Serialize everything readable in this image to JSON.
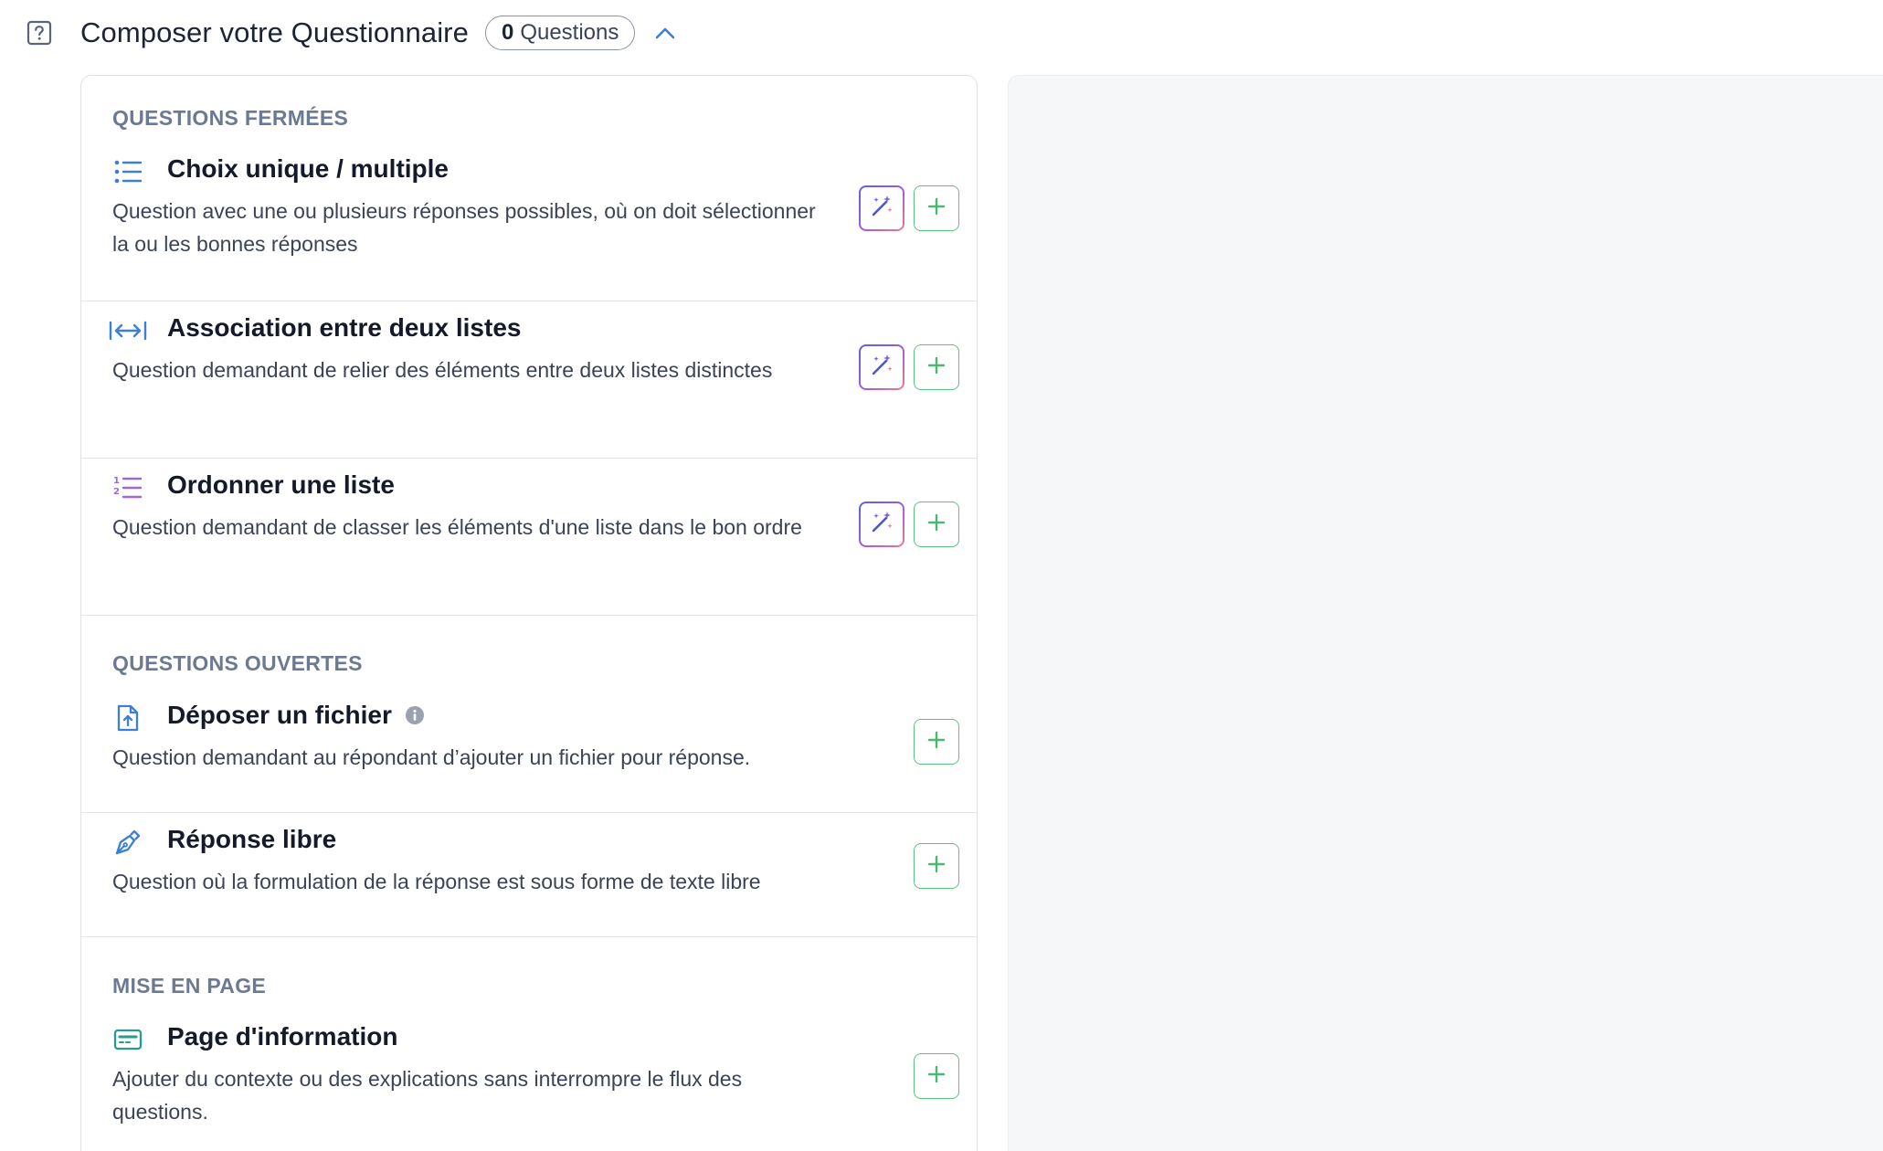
{
  "header": {
    "title": "Composer votre Questionnaire",
    "question_count": "0",
    "question_count_label": "Questions"
  },
  "sections": {
    "closed": {
      "label": "QUESTIONS FERMÉES"
    },
    "open": {
      "label": "QUESTIONS OUVERTES"
    },
    "layout": {
      "label": "MISE EN PAGE"
    }
  },
  "items": {
    "choice": {
      "title": "Choix unique / multiple",
      "description": "Question avec une ou plusieurs réponses possibles, où on doit sélectionner la ou les bonnes réponses",
      "icon": "list-bullets-icon"
    },
    "association": {
      "title": "Association entre deux listes",
      "description": "Question demandant de relier des éléments entre deux listes distinctes",
      "icon": "arrows-horizontal-icon"
    },
    "ordering": {
      "title": "Ordonner une liste",
      "description": "Question demandant de classer les éléments d'une liste dans le bon ordre",
      "icon": "list-numbered-icon"
    },
    "file_upload": {
      "title": "Déposer un fichier",
      "description": "Question demandant au répondant d’ajouter un fichier pour réponse.",
      "icon": "file-upload-icon"
    },
    "free_answer": {
      "title": "Réponse libre",
      "description": "Question où la formulation de la réponse est sous forme de texte libre",
      "icon": "pen-nib-icon"
    },
    "info_page": {
      "title": "Page d'information",
      "description": "Ajouter du contexte ou des explications sans interrompre le flux des questions.",
      "icon": "info-page-icon"
    }
  },
  "colors": {
    "accent_blue": "#3d7fd6",
    "accent_purple": "#9a6ad6",
    "accent_teal": "#2a9a8a",
    "add_green": "#5cc27f",
    "section_label": "#6c7a91",
    "canvas_bg": "#f6f7f9"
  }
}
